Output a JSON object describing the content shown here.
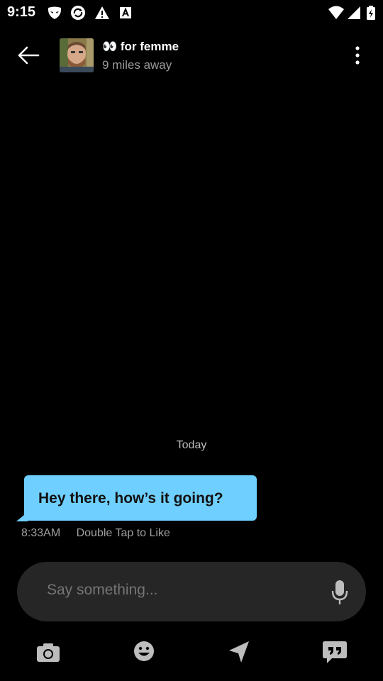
{
  "status_bar": {
    "time": "9:15",
    "left_icons": [
      "grindr-mask-icon",
      "sync-circle-icon",
      "warning-icon",
      "text-app-icon"
    ],
    "right_icons": [
      "wifi-icon",
      "signal-icon",
      "battery-charging-icon"
    ]
  },
  "header": {
    "back_icon": "arrow-left-icon",
    "profile_name": "👀 for femme",
    "profile_distance": "9 miles away",
    "menu_icon": "vertical-dots-icon"
  },
  "conversation": {
    "day_label": "Today",
    "messages": [
      {
        "text": "Hey there, how’s it going?",
        "time": "8:33AM",
        "hint": "Double Tap to Like",
        "bubble_color": "#6fd0ff"
      }
    ]
  },
  "composer": {
    "placeholder": "Say something...",
    "mic_icon": "microphone-icon"
  },
  "bottom_bar": {
    "items": [
      "camera-icon",
      "emoji-icon",
      "location-arrow-icon",
      "quick-phrases-icon"
    ]
  },
  "colors": {
    "background": "#000000",
    "bubble": "#6fd0ff",
    "composer": "#262626",
    "icon_gray": "#bdbdbd"
  }
}
